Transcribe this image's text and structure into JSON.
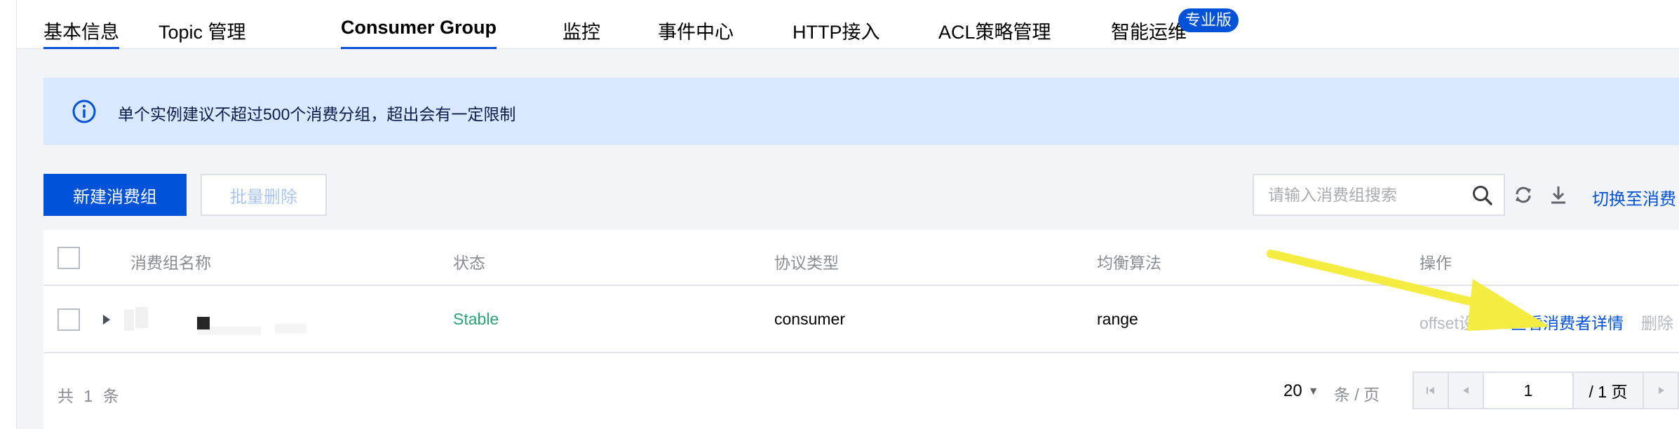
{
  "tabs": [
    {
      "label": "基本信息",
      "active": false
    },
    {
      "label": "Topic 管理",
      "active": false
    },
    {
      "label": "Consumer Group",
      "active": true
    },
    {
      "label": "监控",
      "active": false
    },
    {
      "label": "事件中心",
      "active": false
    },
    {
      "label": "HTTP接入",
      "active": false
    },
    {
      "label": "ACL策略管理",
      "active": false
    },
    {
      "label": "智能运维",
      "active": false
    }
  ],
  "pro_badge": "专业版",
  "alert": {
    "icon": "info-circle-icon",
    "text": "单个实例建议不超过500个消费分组，超出会有一定限制"
  },
  "toolbar": {
    "create_label": "新建消费组",
    "batch_delete_label": "批量删除",
    "search_placeholder": "请输入消费组搜索",
    "switch_label": "切换至消费"
  },
  "table": {
    "columns": [
      "消费组名称",
      "状态",
      "协议类型",
      "均衡算法",
      "操作"
    ],
    "rows": [
      {
        "name": "",
        "status": "Stable",
        "protocol": "consumer",
        "algorithm": "range",
        "actions": [
          "offset设置",
          "查看消费者详情",
          "删除"
        ]
      }
    ]
  },
  "footer": {
    "total_text": "共 1 条",
    "page_size": "20",
    "per_page": "条 / 页",
    "current_page": "1",
    "total_pages": "/ 1 页"
  },
  "colors": {
    "accent": "#0052d9",
    "status_stable": "#2ba471",
    "alert_bg": "#d9e7ff",
    "annotation_arrow": "#f5ec42"
  }
}
